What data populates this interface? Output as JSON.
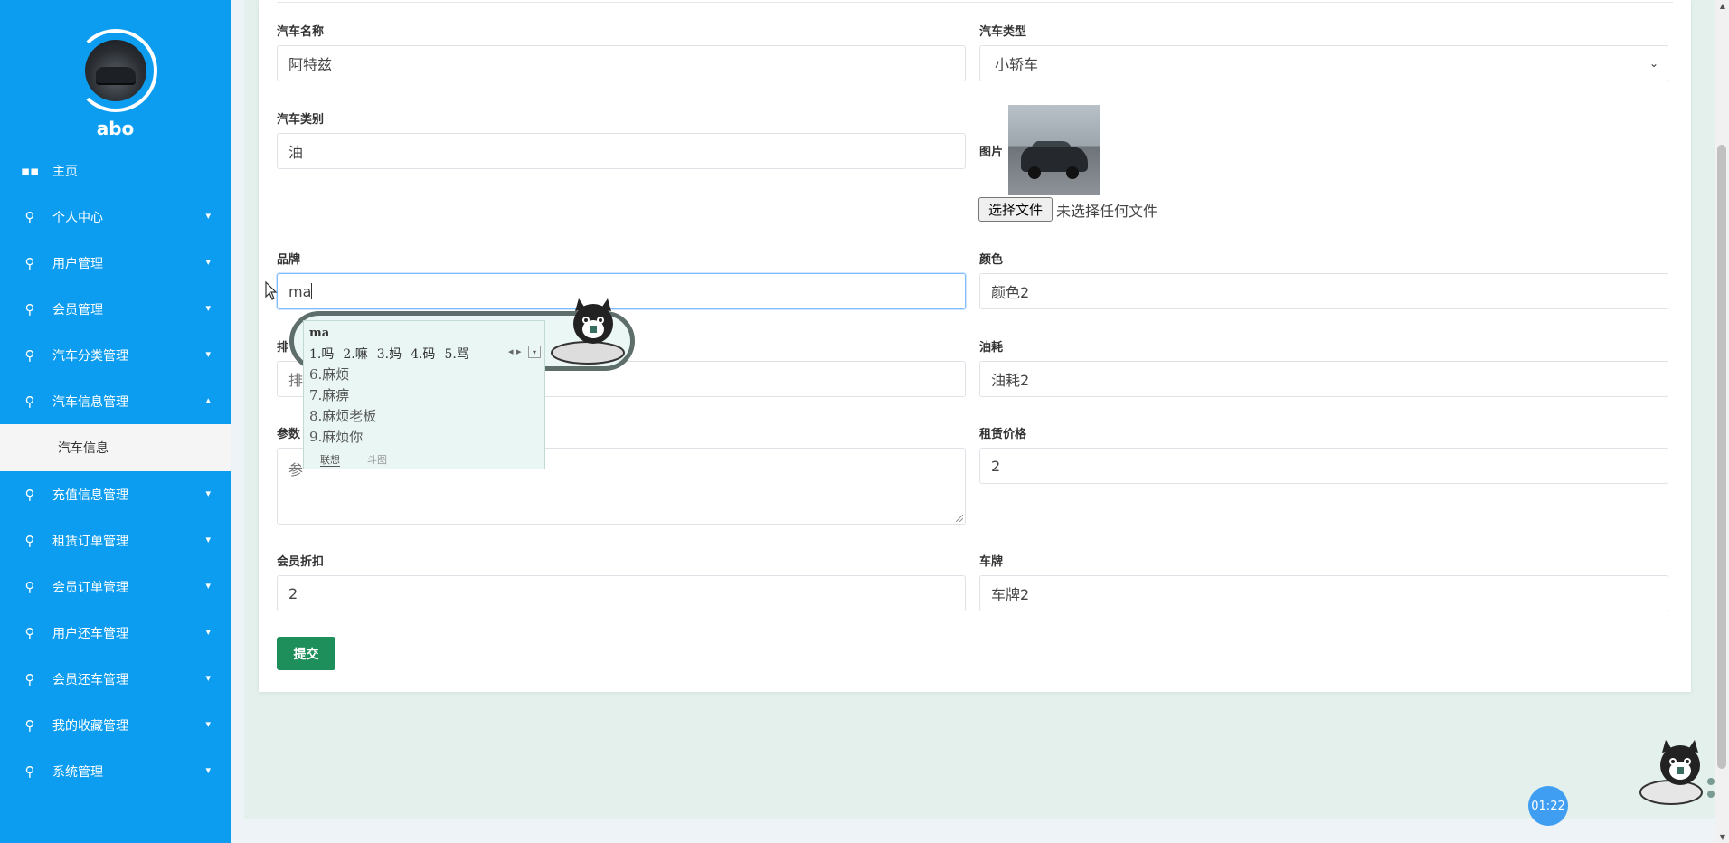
{
  "colors": {
    "sidebar": "#0c9df0",
    "submit": "#1e8e5a",
    "clock": "#3f9df2"
  },
  "sidebar": {
    "username": "abo",
    "items": [
      {
        "label": "主页",
        "icon": "dashboard-icon",
        "has_chevron": false
      },
      {
        "label": "个人中心",
        "icon": "stethoscope-icon",
        "has_chevron": true
      },
      {
        "label": "用户管理",
        "icon": "stethoscope-icon",
        "has_chevron": true
      },
      {
        "label": "会员管理",
        "icon": "stethoscope-icon",
        "has_chevron": true
      },
      {
        "label": "汽车分类管理",
        "icon": "stethoscope-icon",
        "has_chevron": true
      },
      {
        "label": "汽车信息管理",
        "icon": "stethoscope-icon",
        "has_chevron": true,
        "expanded": true
      },
      {
        "label": "充值信息管理",
        "icon": "stethoscope-icon",
        "has_chevron": true
      },
      {
        "label": "租赁订单管理",
        "icon": "stethoscope-icon",
        "has_chevron": true
      },
      {
        "label": "会员订单管理",
        "icon": "stethoscope-icon",
        "has_chevron": true
      },
      {
        "label": "用户还车管理",
        "icon": "stethoscope-icon",
        "has_chevron": true
      },
      {
        "label": "会员还车管理",
        "icon": "stethoscope-icon",
        "has_chevron": true
      },
      {
        "label": "我的收藏管理",
        "icon": "stethoscope-icon",
        "has_chevron": true
      },
      {
        "label": "系统管理",
        "icon": "stethoscope-icon",
        "has_chevron": true
      }
    ],
    "sub_item": "汽车信息"
  },
  "form": {
    "car_name": {
      "label": "汽车名称",
      "value": "阿特兹"
    },
    "car_type": {
      "label": "汽车类型",
      "value": "小轿车"
    },
    "car_category": {
      "label": "汽车类别",
      "value": "油"
    },
    "image": {
      "label": "图片",
      "button": "选择文件",
      "status": "未选择任何文件"
    },
    "brand": {
      "label": "品牌",
      "value": "ma"
    },
    "color": {
      "label": "颜色",
      "value": "颜色2"
    },
    "displacement": {
      "label": "排",
      "value": "排"
    },
    "fuel": {
      "label": "油耗",
      "value": "油耗2"
    },
    "params": {
      "label": "参数",
      "value": "参"
    },
    "rent_price": {
      "label": "租赁价格",
      "value": "2"
    },
    "member_discount": {
      "label": "会员折扣",
      "value": "2"
    },
    "plate": {
      "label": "车牌",
      "value": "车牌2"
    },
    "submit": "提交"
  },
  "ime": {
    "composition": "ma",
    "row1": [
      "1.吗",
      "2.嘛",
      "3.妈",
      "4.码",
      "5.骂"
    ],
    "list": [
      "6.麻烦",
      "7.麻痹",
      "8.麻烦老板",
      "9.麻烦你"
    ],
    "tabs": [
      "联想",
      "斗图"
    ]
  },
  "clock": "01:22"
}
